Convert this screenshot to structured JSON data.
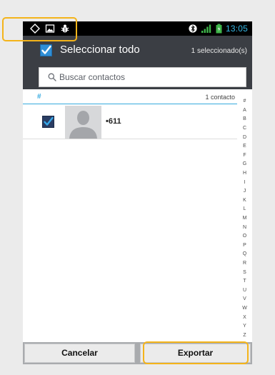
{
  "status_bar": {
    "time": "13:05",
    "left_icons": [
      "location-icon",
      "image-icon",
      "debug-android-icon"
    ],
    "right_icons": [
      "bluetooth-icon",
      "signal-bars-icon",
      "battery-icon"
    ]
  },
  "action_bar": {
    "select_all_label": "Seleccionar todo",
    "selected_count": "1 seleccionado(s)"
  },
  "search": {
    "placeholder": "Buscar contactos"
  },
  "section": {
    "letter": "#",
    "count": "1 contacto"
  },
  "contacts": [
    {
      "name": "•611",
      "checked": true
    }
  ],
  "index_letters": [
    "#",
    "A",
    "B",
    "C",
    "D",
    "E",
    "F",
    "G",
    "H",
    "I",
    "J",
    "K",
    "L",
    "M",
    "N",
    "O",
    "P",
    "Q",
    "R",
    "S",
    "T",
    "U",
    "V",
    "W",
    "X",
    "Y",
    "Z"
  ],
  "buttons": {
    "cancel": "Cancelar",
    "export": "Exportar"
  },
  "colors": {
    "accent": "#33a9e0",
    "action_bar": "#3b3e44",
    "highlight": "#f4b41a",
    "time": "#35b8e5"
  }
}
